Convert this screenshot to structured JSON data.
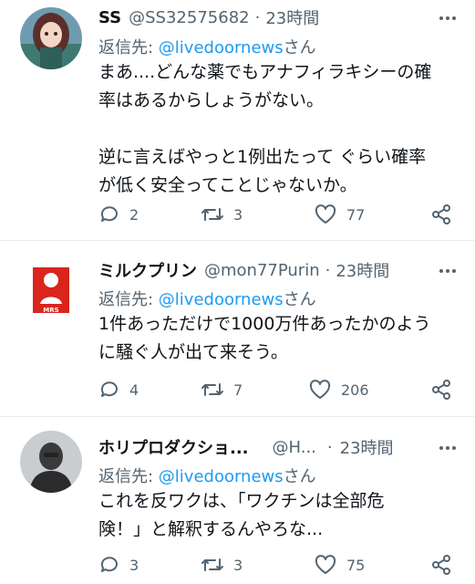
{
  "tweets": [
    {
      "name": "SS",
      "handle": "@SS32575682",
      "sep": "·",
      "time": "23時間",
      "reply_prefix": "返信先: ",
      "reply_link": "@livedoornews",
      "reply_suffix": "さん",
      "lines": [
        "まあ....どんな薬でもアナフィラキシーの確",
        "率はあるからしょうがない。",
        "",
        "逆に言えばやっと1例出たって ぐらい確率",
        "が低く安全ってことじゃないか。"
      ],
      "replies": "2",
      "retweets": "3",
      "likes": "77",
      "avatar_icon": "anime-girl-avatar"
    },
    {
      "name": "ミルクプリン",
      "handle": "@mon77Purin",
      "sep": "·",
      "time": "23時間",
      "reply_prefix": "返信先: ",
      "reply_link": "@livedoornews",
      "reply_suffix": "さん",
      "lines": [
        "1件あっただけで1000万件あったかのよう",
        "に騒ぐ人が出て来そう。"
      ],
      "replies": "4",
      "retweets": "7",
      "likes": "206",
      "avatar_icon": "red-logo-avatar"
    },
    {
      "name": "ホリプロダクショ...",
      "handle": "@H...",
      "sep": "·",
      "time": "23時間",
      "reply_prefix": "返信先: ",
      "reply_link": "@livedoornews",
      "reply_suffix": "さん",
      "lines": [
        "これを反ワクは、「ワクチンは全部危",
        "険！」と解釈するんやろな..."
      ],
      "replies": "3",
      "retweets": "3",
      "likes": "75",
      "avatar_icon": "person-photo-avatar"
    }
  ],
  "icons": {
    "reply": "speech-bubble-icon",
    "retweet": "retweet-icon",
    "like": "heart-icon",
    "share": "share-icon",
    "more": "more-dots-icon"
  },
  "colors": {
    "text": "#0f1419",
    "muted": "#536471",
    "link": "#1d9bf0",
    "divider": "#e6ecf0"
  }
}
